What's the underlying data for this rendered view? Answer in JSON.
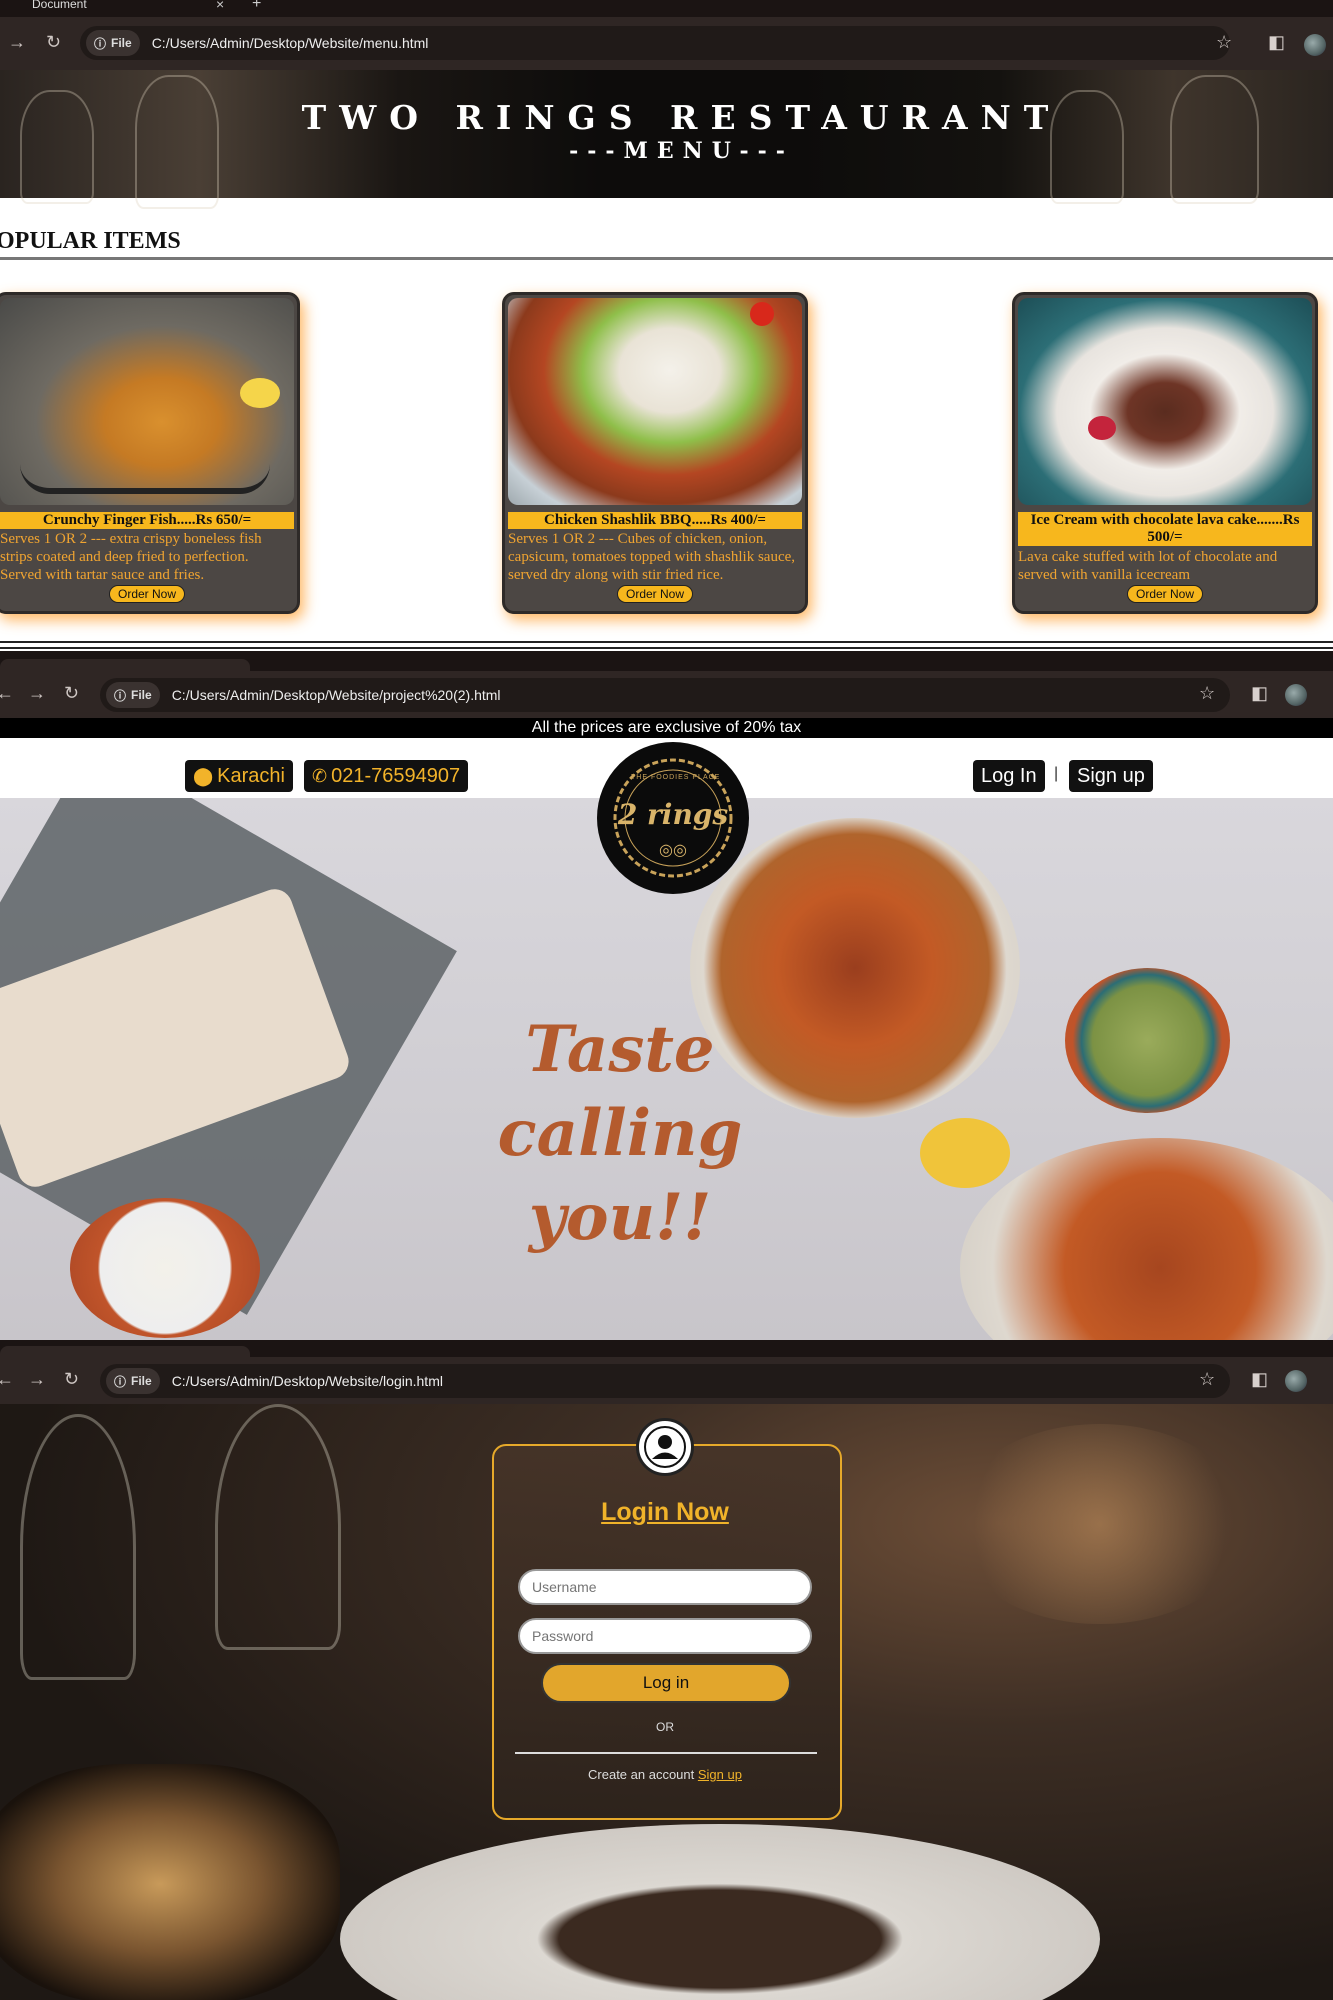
{
  "browser1": {
    "tab_title": "Document",
    "url": "C:/Users/Admin/Desktop/Website/menu.html",
    "file_label": "File"
  },
  "menu": {
    "title": "TWO RINGS RESTAURANT",
    "subtitle": "---MENU---",
    "section_heading": "OPULAR ITEMS",
    "items": [
      {
        "title": "Crunchy Finger Fish.....Rs 650/=",
        "description": "Serves 1 OR 2 --- extra crispy boneless fish strips coated and deep fried to perfection. Served with tartar sauce and fries.",
        "button": "Order Now"
      },
      {
        "title": "Chicken Shashlik BBQ.....Rs 400/=",
        "description": "Serves 1 OR 2 --- Cubes of chicken, onion, capsicum, tomatoes topped with shashlik sauce, served dry along with stir fried rice.",
        "button": "Order Now"
      },
      {
        "title": "Ice Cream with chocolate lava cake.......Rs 500/=",
        "description": "Lava cake stuffed with lot of chocolate and served with vanilla icecream",
        "button": "Order Now"
      }
    ]
  },
  "browser2": {
    "url": "C:/Users/Admin/Desktop/Website/project%20(2).html",
    "file_label": "File"
  },
  "home": {
    "tax_notice": "All the prices are exclusive of 20% tax",
    "location": "Karachi",
    "phone": "021-76594907",
    "login": "Log In",
    "divider": "|",
    "signup": "Sign up",
    "logo_text": "2 rings",
    "logo_ring_text": "THE FOODIES PLACE",
    "hero_lines": [
      "Taste",
      "calling",
      "you!!"
    ]
  },
  "browser3": {
    "url": "C:/Users/Admin/Desktop/Website/login.html",
    "file_label": "File"
  },
  "login": {
    "title": "Login Now",
    "username_placeholder": "Username",
    "password_placeholder": "Password",
    "button": "Log in",
    "or": "OR",
    "create_text": "Create an account",
    "signup_link": "Sign up"
  },
  "colors": {
    "accent": "#f7b71d",
    "gold": "#e2a62c",
    "dark": "#111111",
    "hero_text": "#b45b2e"
  },
  "icons": [
    "back-icon",
    "forward-icon",
    "reload-icon",
    "info-icon",
    "star-icon",
    "sidepanel-icon",
    "location-pin-icon",
    "phone-icon",
    "user-avatar-icon"
  ]
}
